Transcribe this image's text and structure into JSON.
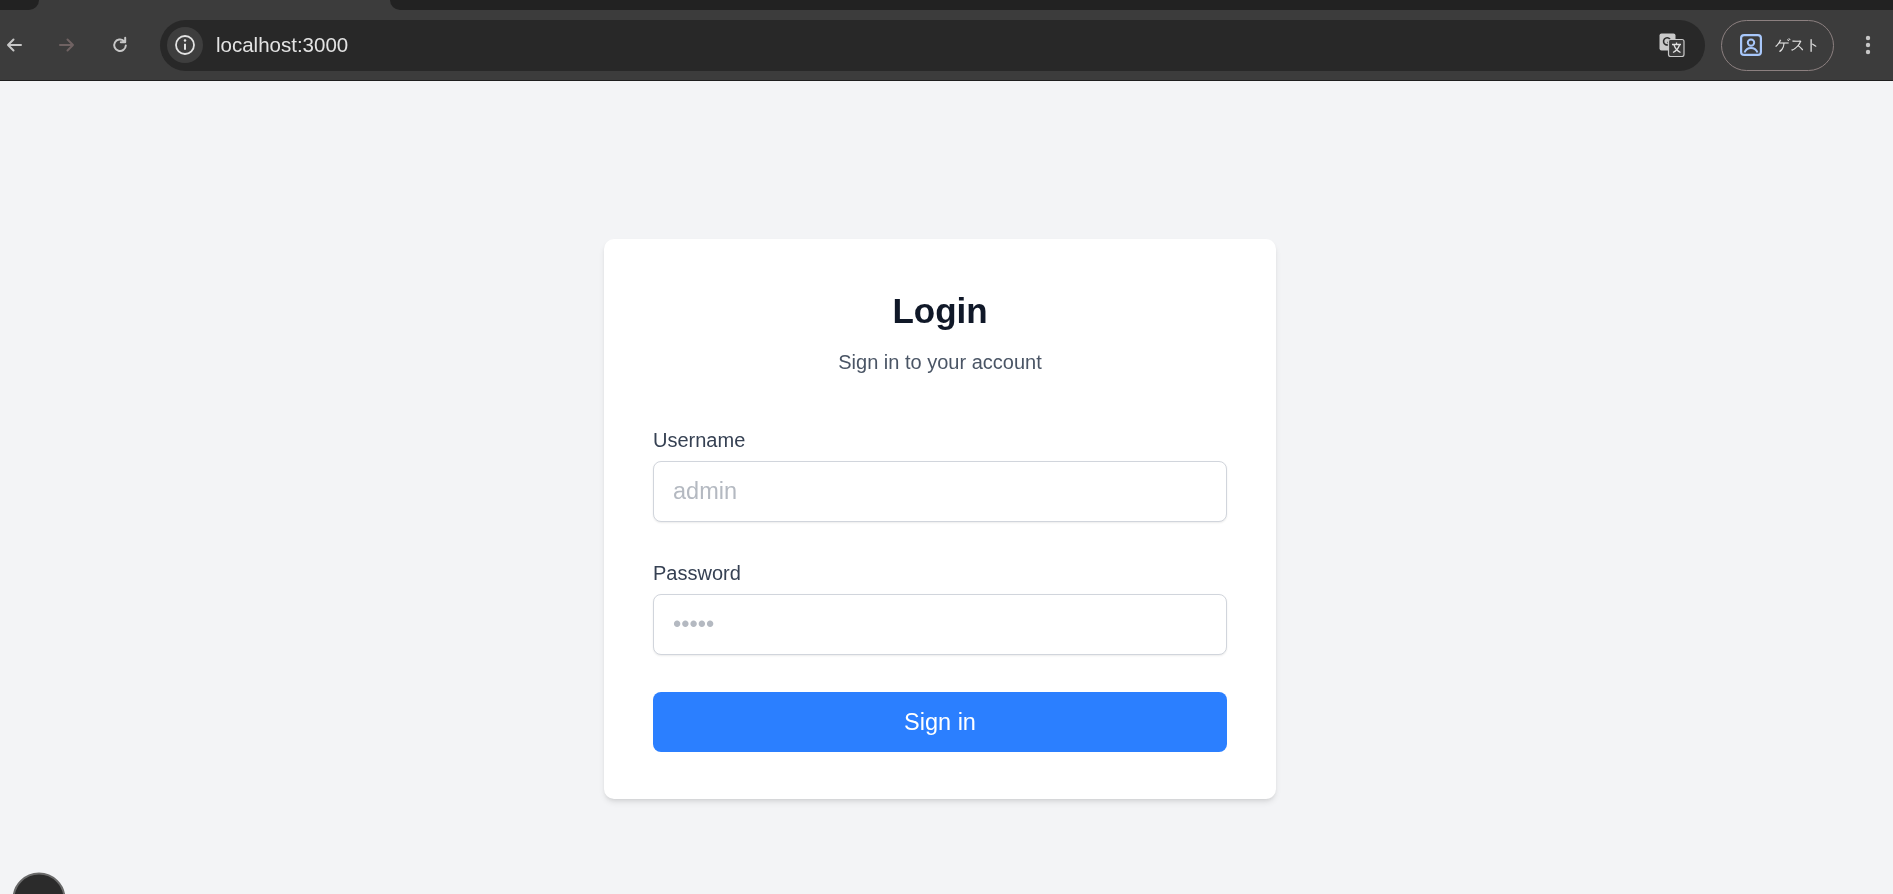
{
  "browser": {
    "nav_buttons": [
      {
        "kind": "back",
        "disabled": false
      },
      {
        "kind": "forward",
        "disabled": true
      },
      {
        "kind": "reload",
        "disabled": false
      }
    ],
    "address_bar": {
      "url": "localhost:3000"
    },
    "profile": {
      "label": "ゲスト"
    }
  },
  "login": {
    "title": "Login",
    "subtitle": "Sign in to your account",
    "fields": [
      {
        "label": "Username",
        "placeholder": "admin"
      },
      {
        "label": "Password",
        "placeholder": "•••••"
      }
    ],
    "submit_button": "Sign in"
  }
}
